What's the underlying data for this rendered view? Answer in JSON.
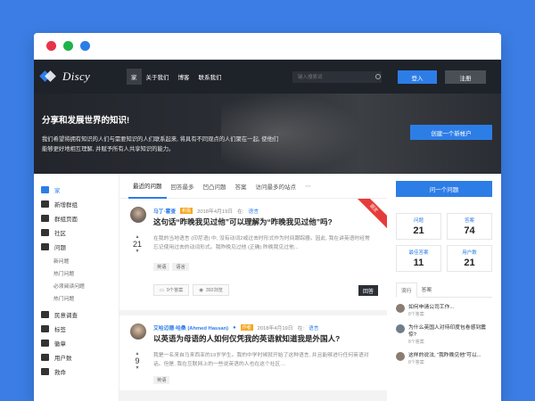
{
  "window": {
    "dot_colors": [
      "#e8334a",
      "#1db34a",
      "#2d7de7"
    ]
  },
  "header": {
    "brand": "Discy",
    "nav": [
      "家",
      "关于我们",
      "博客",
      "联系我们"
    ],
    "search_placeholder": "键入搜索词",
    "login": "登入",
    "register": "注册"
  },
  "hero": {
    "title": "分享和发展世界的知识!",
    "text": "我们希望将拥有知识的人们与需要知识的人们联系起来, 将具有不同观点的人们聚在一起, 使他们能够更好地相互理解, 并赋予所有人共享知识的能力。",
    "cta": "创建一个新帐户"
  },
  "sidebar": {
    "items": [
      {
        "label": "家",
        "icon": "home-icon",
        "active": true
      },
      {
        "label": "新增群组",
        "icon": "users-icon"
      },
      {
        "label": "群组页面",
        "icon": "group-icon"
      },
      {
        "label": "社区",
        "icon": "community-icon"
      },
      {
        "label": "问题",
        "icon": "book-icon"
      }
    ],
    "sub_items": [
      "新问题",
      "热门问题",
      "必须阅读问题",
      "热门问题"
    ],
    "items2": [
      {
        "label": "民意调查",
        "icon": "poll-icon"
      },
      {
        "label": "标签",
        "icon": "tag-icon"
      },
      {
        "label": "徽章",
        "icon": "trophy-icon"
      },
      {
        "label": "用户数",
        "icon": "user-icon"
      },
      {
        "label": "救命",
        "icon": "help-icon"
      }
    ]
  },
  "tabs": [
    "最近的问题",
    "回答最多",
    "凹凸问题",
    "答案",
    "访问最多的站点",
    "⋯"
  ],
  "questions": [
    {
      "user": "马丁·霍查",
      "badge": "积极",
      "date": "2018年4月19日",
      "in_label": "在:",
      "category": "语言",
      "title": "这句话“昨晚我见过他”可以理解为“昨晚我见过他”吗?",
      "votes": "21",
      "excerpt": "在我的当地语言 (印尼语) 中, 没有动词2或过去时形式作为时间跟踪器。因此, 我在讲英语时经常忘记使用过去的动词形式。我昨晚见过他 (正确) 昨晚我见过他...",
      "tags": [
        "英语",
        "语言"
      ],
      "answers": "9个答案",
      "views": "392浏览",
      "answer_button": "回答",
      "ribbon": "固定"
    },
    {
      "user": "艾哈迈德·哈桑 (Ahmed Hassan)",
      "badge": "作者",
      "date": "2018年4月19日",
      "in_label": "在:",
      "category": "语言",
      "title": "以英语为母语的人如何仅凭我的英语就知道我是外国人?",
      "votes": "9",
      "excerpt": "我是一名来自马来西亚的19岁学生。我的中学时候就开始了这种语言, 并且能够进行任何英语对话。但是, 我在互联网上的一些说英语的人也在这个社区…",
      "tags": [
        "英语"
      ]
    }
  ],
  "right": {
    "ask": "问一个问题",
    "stats": [
      {
        "label": "问题",
        "value": "21"
      },
      {
        "label": "答案",
        "value": "74"
      },
      {
        "label": "最佳答案",
        "value": "11"
      },
      {
        "label": "用户数",
        "value": "21"
      }
    ],
    "tabs": [
      "流行",
      "答案"
    ],
    "popular": [
      {
        "title": "如何申请公司工作...",
        "answers": "8个答案"
      },
      {
        "title": "为什么英国人对待印度包卷感到震惊?",
        "answers": "8个答案"
      },
      {
        "title": "这样的说法, “我昨晚见他”可以...",
        "answers": "8个答案"
      }
    ]
  }
}
